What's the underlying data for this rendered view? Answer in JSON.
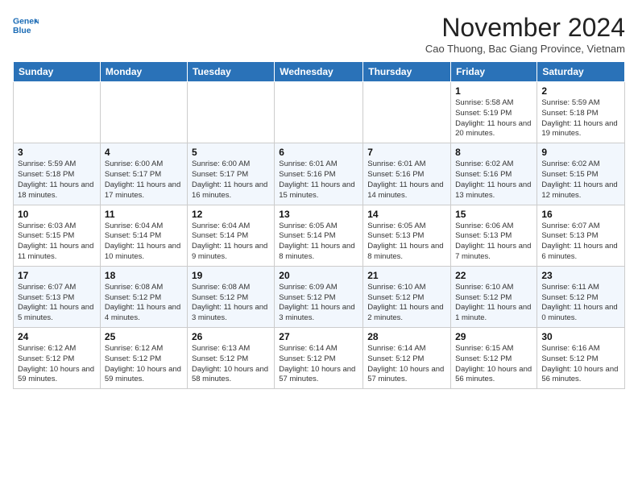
{
  "header": {
    "logo_line1": "General",
    "logo_line2": "Blue",
    "month": "November 2024",
    "location": "Cao Thuong, Bac Giang Province, Vietnam"
  },
  "weekdays": [
    "Sunday",
    "Monday",
    "Tuesday",
    "Wednesday",
    "Thursday",
    "Friday",
    "Saturday"
  ],
  "weeks": [
    [
      {
        "day": "",
        "info": ""
      },
      {
        "day": "",
        "info": ""
      },
      {
        "day": "",
        "info": ""
      },
      {
        "day": "",
        "info": ""
      },
      {
        "day": "",
        "info": ""
      },
      {
        "day": "1",
        "info": "Sunrise: 5:58 AM\nSunset: 5:19 PM\nDaylight: 11 hours and 20 minutes."
      },
      {
        "day": "2",
        "info": "Sunrise: 5:59 AM\nSunset: 5:18 PM\nDaylight: 11 hours and 19 minutes."
      }
    ],
    [
      {
        "day": "3",
        "info": "Sunrise: 5:59 AM\nSunset: 5:18 PM\nDaylight: 11 hours and 18 minutes."
      },
      {
        "day": "4",
        "info": "Sunrise: 6:00 AM\nSunset: 5:17 PM\nDaylight: 11 hours and 17 minutes."
      },
      {
        "day": "5",
        "info": "Sunrise: 6:00 AM\nSunset: 5:17 PM\nDaylight: 11 hours and 16 minutes."
      },
      {
        "day": "6",
        "info": "Sunrise: 6:01 AM\nSunset: 5:16 PM\nDaylight: 11 hours and 15 minutes."
      },
      {
        "day": "7",
        "info": "Sunrise: 6:01 AM\nSunset: 5:16 PM\nDaylight: 11 hours and 14 minutes."
      },
      {
        "day": "8",
        "info": "Sunrise: 6:02 AM\nSunset: 5:16 PM\nDaylight: 11 hours and 13 minutes."
      },
      {
        "day": "9",
        "info": "Sunrise: 6:02 AM\nSunset: 5:15 PM\nDaylight: 11 hours and 12 minutes."
      }
    ],
    [
      {
        "day": "10",
        "info": "Sunrise: 6:03 AM\nSunset: 5:15 PM\nDaylight: 11 hours and 11 minutes."
      },
      {
        "day": "11",
        "info": "Sunrise: 6:04 AM\nSunset: 5:14 PM\nDaylight: 11 hours and 10 minutes."
      },
      {
        "day": "12",
        "info": "Sunrise: 6:04 AM\nSunset: 5:14 PM\nDaylight: 11 hours and 9 minutes."
      },
      {
        "day": "13",
        "info": "Sunrise: 6:05 AM\nSunset: 5:14 PM\nDaylight: 11 hours and 8 minutes."
      },
      {
        "day": "14",
        "info": "Sunrise: 6:05 AM\nSunset: 5:13 PM\nDaylight: 11 hours and 8 minutes."
      },
      {
        "day": "15",
        "info": "Sunrise: 6:06 AM\nSunset: 5:13 PM\nDaylight: 11 hours and 7 minutes."
      },
      {
        "day": "16",
        "info": "Sunrise: 6:07 AM\nSunset: 5:13 PM\nDaylight: 11 hours and 6 minutes."
      }
    ],
    [
      {
        "day": "17",
        "info": "Sunrise: 6:07 AM\nSunset: 5:13 PM\nDaylight: 11 hours and 5 minutes."
      },
      {
        "day": "18",
        "info": "Sunrise: 6:08 AM\nSunset: 5:12 PM\nDaylight: 11 hours and 4 minutes."
      },
      {
        "day": "19",
        "info": "Sunrise: 6:08 AM\nSunset: 5:12 PM\nDaylight: 11 hours and 3 minutes."
      },
      {
        "day": "20",
        "info": "Sunrise: 6:09 AM\nSunset: 5:12 PM\nDaylight: 11 hours and 3 minutes."
      },
      {
        "day": "21",
        "info": "Sunrise: 6:10 AM\nSunset: 5:12 PM\nDaylight: 11 hours and 2 minutes."
      },
      {
        "day": "22",
        "info": "Sunrise: 6:10 AM\nSunset: 5:12 PM\nDaylight: 11 hours and 1 minute."
      },
      {
        "day": "23",
        "info": "Sunrise: 6:11 AM\nSunset: 5:12 PM\nDaylight: 11 hours and 0 minutes."
      }
    ],
    [
      {
        "day": "24",
        "info": "Sunrise: 6:12 AM\nSunset: 5:12 PM\nDaylight: 10 hours and 59 minutes."
      },
      {
        "day": "25",
        "info": "Sunrise: 6:12 AM\nSunset: 5:12 PM\nDaylight: 10 hours and 59 minutes."
      },
      {
        "day": "26",
        "info": "Sunrise: 6:13 AM\nSunset: 5:12 PM\nDaylight: 10 hours and 58 minutes."
      },
      {
        "day": "27",
        "info": "Sunrise: 6:14 AM\nSunset: 5:12 PM\nDaylight: 10 hours and 57 minutes."
      },
      {
        "day": "28",
        "info": "Sunrise: 6:14 AM\nSunset: 5:12 PM\nDaylight: 10 hours and 57 minutes."
      },
      {
        "day": "29",
        "info": "Sunrise: 6:15 AM\nSunset: 5:12 PM\nDaylight: 10 hours and 56 minutes."
      },
      {
        "day": "30",
        "info": "Sunrise: 6:16 AM\nSunset: 5:12 PM\nDaylight: 10 hours and 56 minutes."
      }
    ]
  ]
}
